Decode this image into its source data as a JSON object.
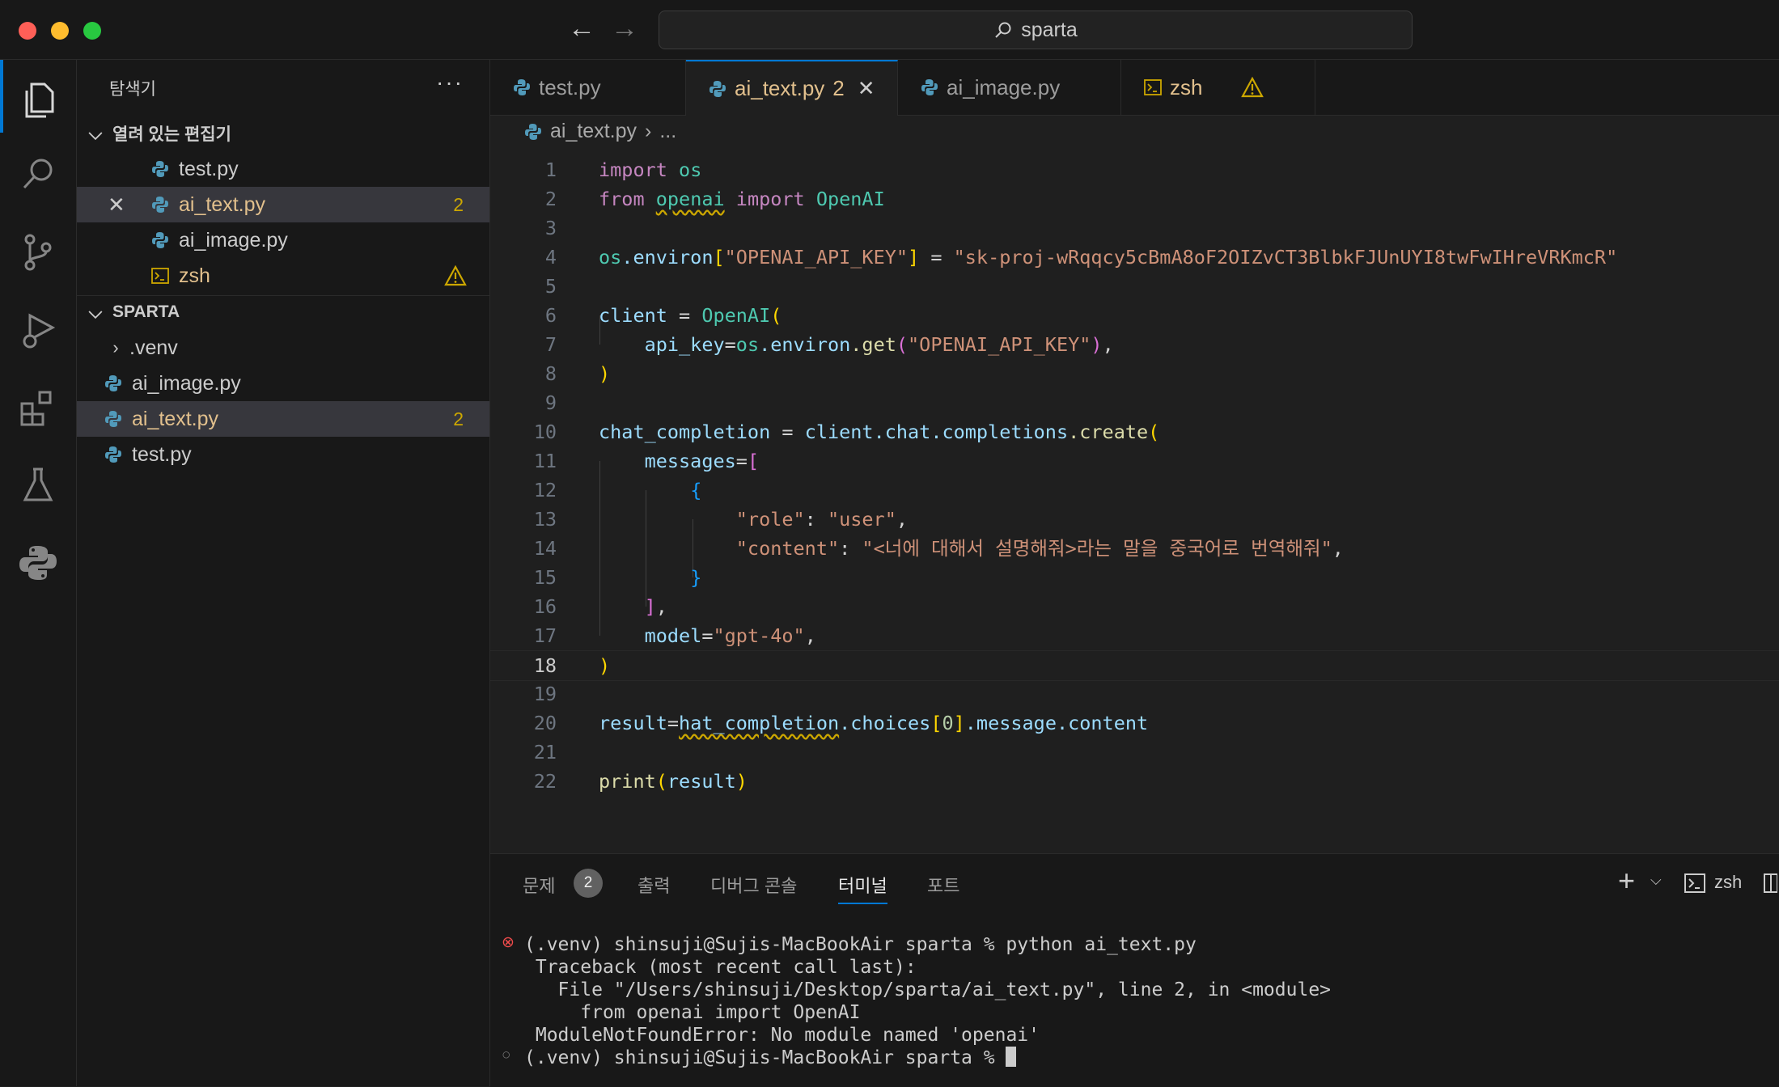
{
  "window": {
    "search_text": "sparta"
  },
  "sidebar": {
    "title": "탐색기",
    "more_label": "···",
    "open_editors_label": "열려 있는 편집기",
    "open_editors": [
      {
        "name": "test.py",
        "badge": ""
      },
      {
        "name": "ai_text.py",
        "badge": "2"
      },
      {
        "name": "ai_image.py",
        "badge": ""
      },
      {
        "name": "zsh",
        "badge": ""
      }
    ],
    "project_label": "SPARTA",
    "project_items": [
      {
        "name": ".venv",
        "badge": ""
      },
      {
        "name": "ai_image.py",
        "badge": ""
      },
      {
        "name": "ai_text.py",
        "badge": "2"
      },
      {
        "name": "test.py",
        "badge": ""
      }
    ]
  },
  "tabs": [
    {
      "label": "test.py",
      "badge": ""
    },
    {
      "label": "ai_text.py",
      "badge": "2"
    },
    {
      "label": "ai_image.py",
      "badge": ""
    },
    {
      "label": "zsh",
      "badge": ""
    }
  ],
  "breadcrumb": {
    "file": "ai_text.py",
    "rest": "..."
  },
  "editor": {
    "current_line": 18,
    "line_numbers": [
      "1",
      "2",
      "3",
      "4",
      "5",
      "6",
      "7",
      "8",
      "9",
      "10",
      "11",
      "12",
      "13",
      "14",
      "15",
      "16",
      "17",
      "18",
      "19",
      "20",
      "21",
      "22"
    ],
    "code": {
      "l1_kw": "import",
      "l1_mod": "os",
      "l2_kw1": "from",
      "l2_mod": "openai",
      "l2_kw2": "import",
      "l2_cls": "OpenAI",
      "l4_var": "os",
      "l4_attr": ".environ",
      "l4_key": "\"OPENAI_API_KEY\"",
      "l4_eq": " = ",
      "l4_val": "\"sk-proj-wRqqcy5cBmA8oF2OIZvCT3BlbkFJUnUYI8twFwIHreVRKmcR\"",
      "l6_var": "client",
      "l6_eq": " = ",
      "l6_cls": "OpenAI",
      "l7_param": "api_key",
      "l7_var": "os",
      "l7_attr": ".environ",
      "l7_fn": ".get",
      "l7_str": "\"OPENAI_API_KEY\"",
      "l10_var": "chat_completion",
      "l10_eq": " = ",
      "l10_obj": "client",
      "l10_attr": ".chat.completions",
      "l10_fn": ".create",
      "l11_param": "messages",
      "l13_key": "\"role\"",
      "l13_val": "\"user\"",
      "l14_key": "\"content\"",
      "l14_val": "\"<너에 대해서 설명해줘>라는 말을 중국어로 번역해줘\"",
      "l17_param": "model",
      "l17_val": "\"gpt-4o\"",
      "l20_var": "result",
      "l20_obj": "hat_completion",
      "l20_attr": ".choices",
      "l20_idx": "0",
      "l20_rest": ".message.content",
      "l22_fn": "print",
      "l22_arg": "result"
    }
  },
  "panel": {
    "tabs": [
      "문제",
      "출력",
      "디버그 콘솔",
      "터미널",
      "포트"
    ],
    "problems_count": "2",
    "shell_label": "zsh",
    "terminal_lines": [
      "(.venv) shinsuji@Sujis-MacBookAir sparta % python ai_text.py",
      "Traceback (most recent call last):",
      "  File \"/Users/shinsuji/Desktop/sparta/ai_text.py\", line 2, in <module>",
      "    from openai import OpenAI",
      "ModuleNotFoundError: No module named 'openai'",
      "(.venv) shinsuji@Sujis-MacBookAir sparta % "
    ]
  },
  "colors": {
    "accent": "#0078d4",
    "modified": "#e2c08d",
    "warning": "#cca700",
    "error": "#f14c4c"
  }
}
